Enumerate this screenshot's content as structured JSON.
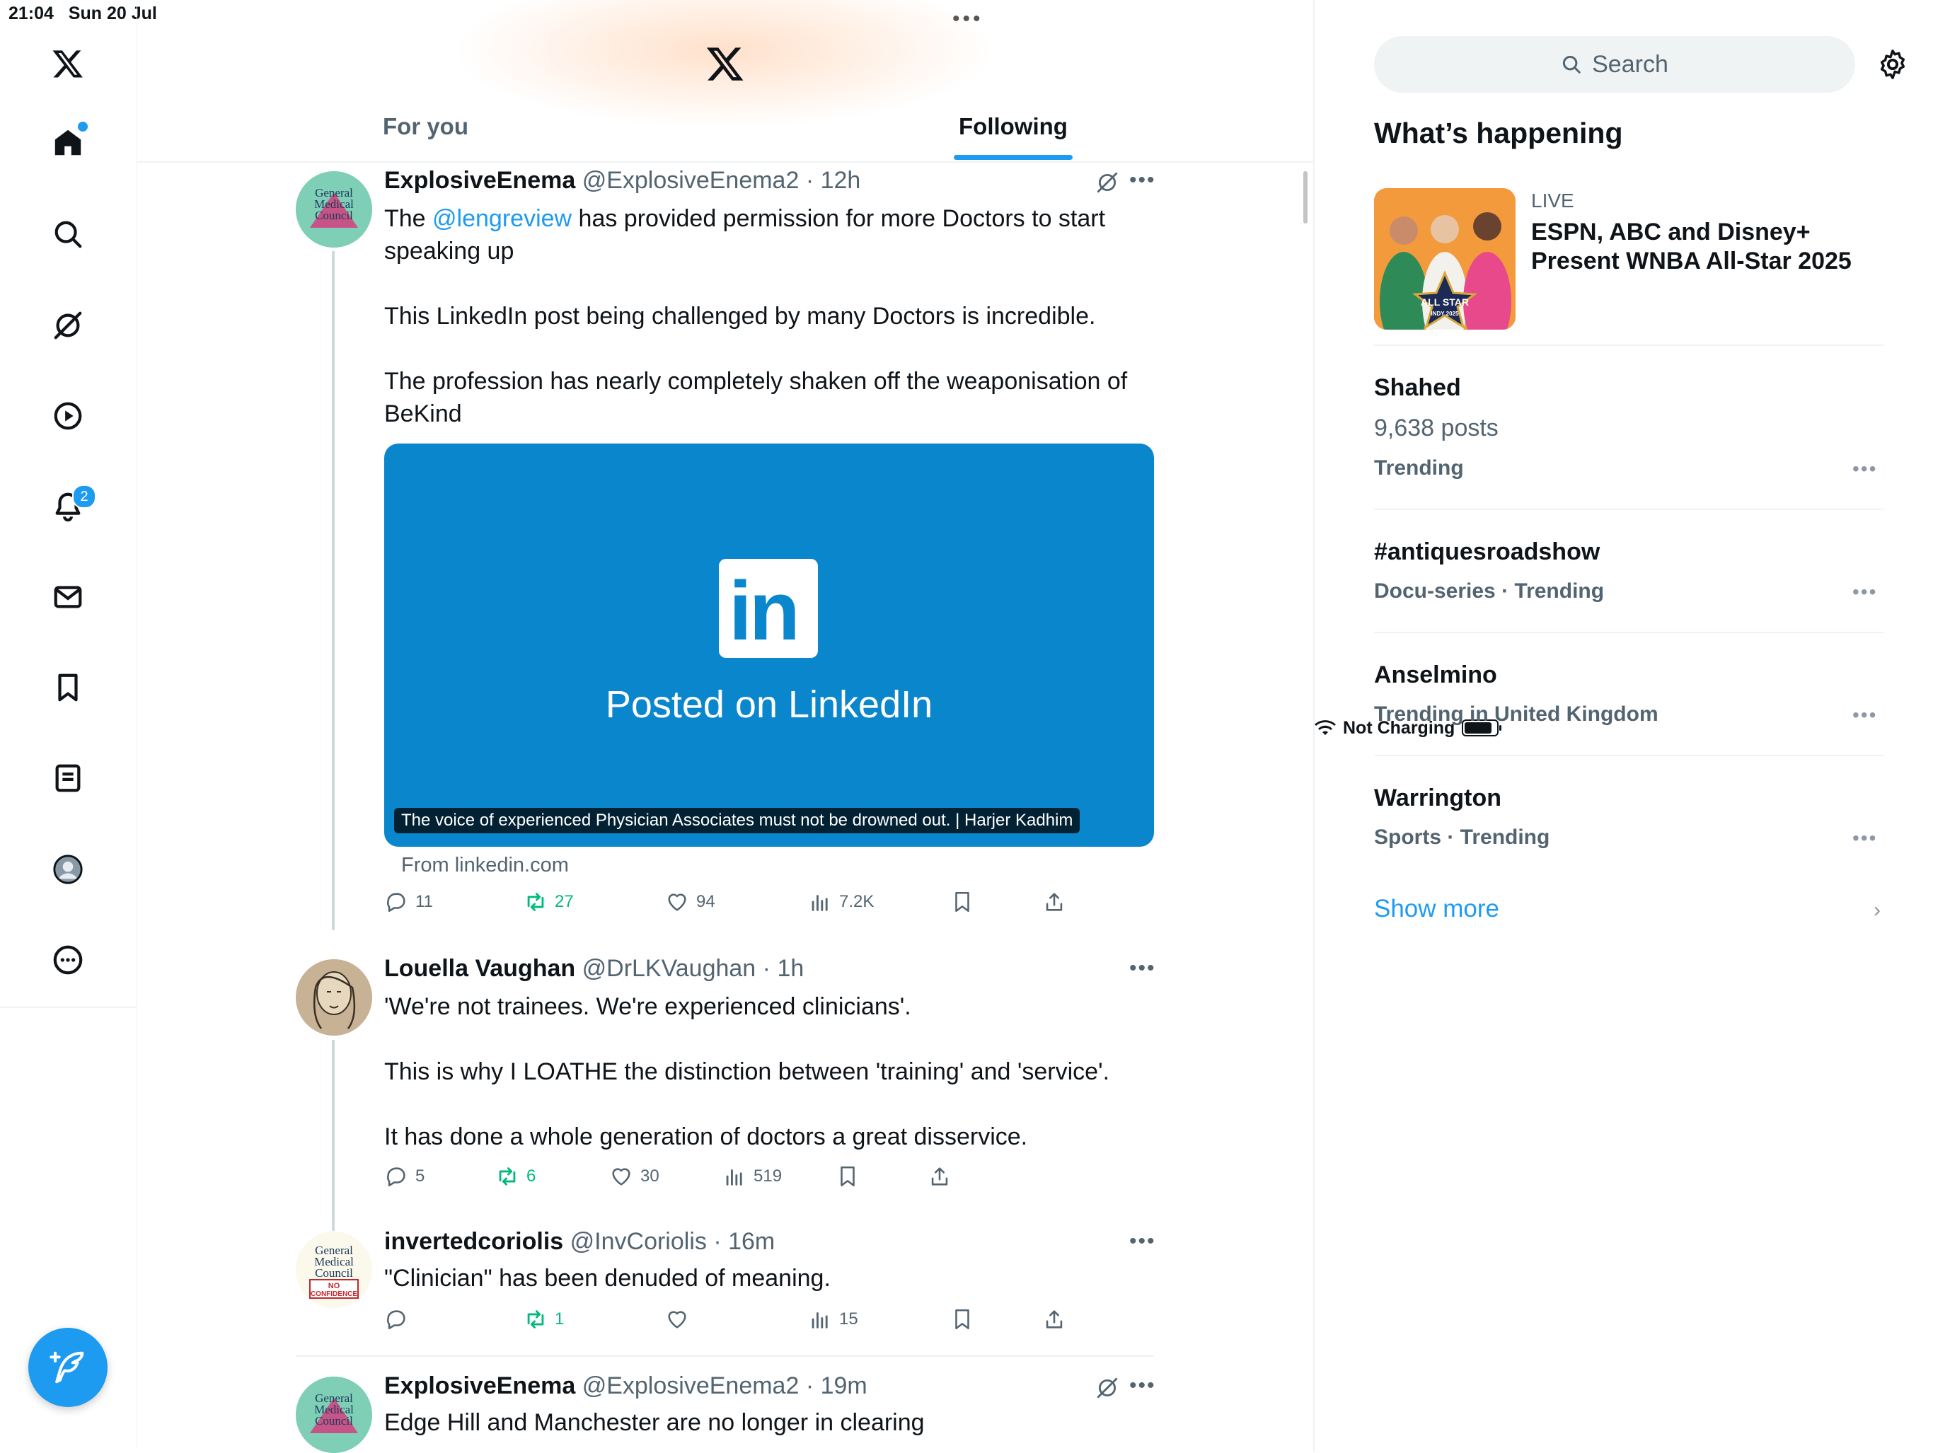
{
  "status_bar": {
    "time": "21:04",
    "date": "Sun 20 Jul",
    "charging": "Not Charging"
  },
  "nav": {
    "logo": "x-logo-icon",
    "items": [
      "home-icon",
      "search-icon",
      "grok-icon",
      "video-icon",
      "notifications-icon",
      "messages-icon",
      "bookmarks-icon",
      "lists-icon",
      "profile-icon",
      "more-icon"
    ],
    "notification_count": "2"
  },
  "header": {
    "tabs": [
      {
        "label": "For you"
      },
      {
        "label": "Following"
      }
    ]
  },
  "tweets": [
    {
      "name": "ExplosiveEnema",
      "handle": "@ExplosiveEnema2",
      "time": "12h",
      "text_parts": {
        "prefix": "The ",
        "mention": "@lengreview",
        "suffix": " has provided permission for more Doctors to start speaking up"
      },
      "p2": "This LinkedIn post being challenged by many Doctors is incredible.",
      "p3": "The profession has nearly completely shaken off the weaponisation of BeKind",
      "card": {
        "logo": "in",
        "title": "Posted on LinkedIn",
        "caption": "The voice of experienced Physician Associates must not be drowned out. | Harjer Kadhim",
        "source": "From linkedin.com"
      },
      "stats": {
        "replies": "11",
        "reposts": "27",
        "likes": "94",
        "views": "7.2K"
      }
    },
    {
      "name": "Louella Vaughan",
      "handle": "@DrLKVaughan",
      "time": "1h",
      "p1": "'We're not trainees. We're experienced clinicians'.",
      "p2": "This is why I LOATHE the distinction between 'training' and 'service'.",
      "p3": "It has done a whole generation of doctors a great disservice.",
      "stats": {
        "replies": "5",
        "reposts": "6",
        "likes": "30",
        "views": "519"
      }
    },
    {
      "name": "invertedcoriolis",
      "handle": "@InvCoriolis",
      "time": "16m",
      "p1": "\"Clinician\" has been denuded of meaning.",
      "stats": {
        "replies": "",
        "reposts": "1",
        "likes": "",
        "views": "15"
      }
    },
    {
      "name": "ExplosiveEnema",
      "handle": "@ExplosiveEnema2",
      "time": "19m",
      "p1": "Edge Hill and Manchester are no longer in clearing"
    }
  ],
  "avatar_text": {
    "gmc_line1": "General",
    "gmc_line2": "Medical",
    "gmc_line3": "Council",
    "no_conf_1": "NO",
    "no_conf_2": "CONFIDENCE"
  },
  "sidebar": {
    "search_placeholder": "Search",
    "title": "What’s happening",
    "live": {
      "label": "LIVE",
      "title": "ESPN, ABC and Disney+ Present WNBA All-Star 2025",
      "badge": "ALL STAR",
      "badge_sub": "INDY 2025"
    },
    "trends": [
      {
        "title": "Shahed",
        "sub": "9,638 posts",
        "meta": "Trending"
      },
      {
        "title": "#antiquesroadshow",
        "meta": "Docu-series · Trending"
      },
      {
        "title": "Anselmino",
        "meta": "Trending in United Kingdom"
      },
      {
        "title": "Warrington",
        "meta": "Sports · Trending"
      }
    ],
    "show_more": "Show more"
  },
  "colors": {
    "accent": "#1d9bf0",
    "repost": "#00ba7c",
    "linkedin": "#0a86cd",
    "muted": "#536471"
  }
}
